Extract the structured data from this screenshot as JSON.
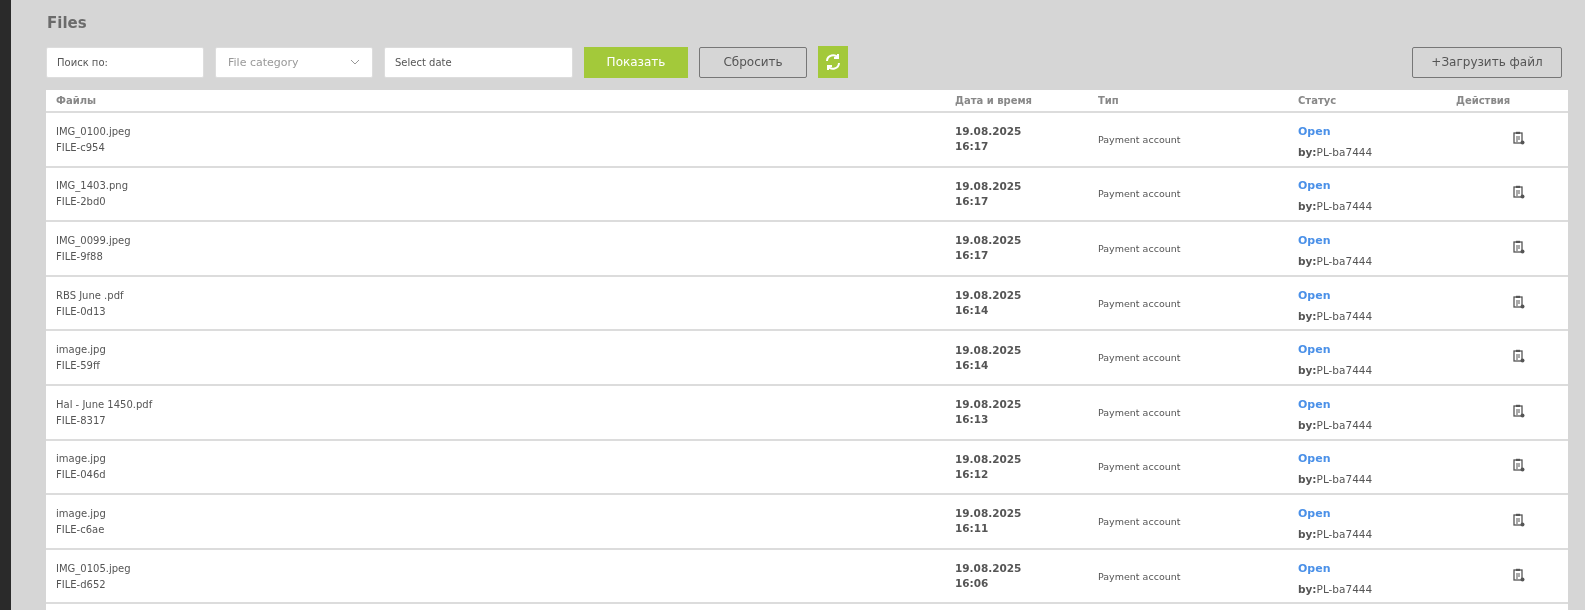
{
  "title": "Files",
  "filters": {
    "search": {
      "placeholder": "Поиск по:"
    },
    "category": {
      "placeholder": "File category"
    },
    "date": {
      "placeholder": "Select date"
    },
    "show_button": "Показать",
    "reset_button": "Сбросить",
    "upload_button": "+Загрузить файл"
  },
  "table": {
    "columns": [
      "Файлы",
      "Дата и время",
      "Тип",
      "Статус",
      "Действия"
    ],
    "rows": [
      {
        "name": "IMG_0100.jpeg",
        "id": "FILE-c954",
        "date": "19.08.2025",
        "time": "16:17",
        "type": "Payment account",
        "status": "Open",
        "by_label": "by:",
        "by": "PL-ba7444"
      },
      {
        "name": "IMG_1403.png",
        "id": "FILE-2bd0",
        "date": "19.08.2025",
        "time": "16:17",
        "type": "Payment account",
        "status": "Open",
        "by_label": "by:",
        "by": "PL-ba7444"
      },
      {
        "name": "IMG_0099.jpeg",
        "id": "FILE-9f88",
        "date": "19.08.2025",
        "time": "16:17",
        "type": "Payment account",
        "status": "Open",
        "by_label": "by:",
        "by": "PL-ba7444"
      },
      {
        "name": "RBS June .pdf",
        "id": "FILE-0d13",
        "date": "19.08.2025",
        "time": "16:14",
        "type": "Payment account",
        "status": "Open",
        "by_label": "by:",
        "by": "PL-ba7444"
      },
      {
        "name": "image.jpg",
        "id": "FILE-59ff",
        "date": "19.08.2025",
        "time": "16:14",
        "type": "Payment account",
        "status": "Open",
        "by_label": "by:",
        "by": "PL-ba7444"
      },
      {
        "name": "Hal - June 1450.pdf",
        "id": "FILE-8317",
        "date": "19.08.2025",
        "time": "16:13",
        "type": "Payment account",
        "status": "Open",
        "by_label": "by:",
        "by": "PL-ba7444"
      },
      {
        "name": "image.jpg",
        "id": "FILE-046d",
        "date": "19.08.2025",
        "time": "16:12",
        "type": "Payment account",
        "status": "Open",
        "by_label": "by:",
        "by": "PL-ba7444"
      },
      {
        "name": "image.jpg",
        "id": "FILE-c6ae",
        "date": "19.08.2025",
        "time": "16:11",
        "type": "Payment account",
        "status": "Open",
        "by_label": "by:",
        "by": "PL-ba7444"
      },
      {
        "name": "IMG_0105.jpeg",
        "id": "FILE-d652",
        "date": "19.08.2025",
        "time": "16:06",
        "type": "Payment account",
        "status": "Open",
        "by_label": "by:",
        "by": "PL-ba7444"
      }
    ]
  }
}
